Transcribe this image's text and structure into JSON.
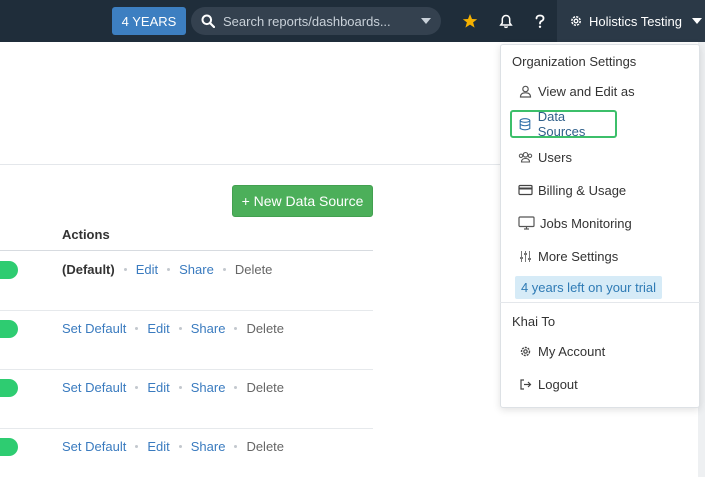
{
  "topbar": {
    "plan_badge": "4 YEARS",
    "search_placeholder": "Search reports/dashboards...",
    "icons": [
      "star-icon",
      "bell-icon",
      "help-icon",
      "gear-icon"
    ],
    "org_name": "Holistics Testing",
    "colors": {
      "bar": "#1f2d3a",
      "badge": "#3d7fc1",
      "star": "#f5b100"
    }
  },
  "main": {
    "new_button_label": "+ New Data Source",
    "actions_header": "Actions",
    "rows": [
      {
        "default_label": "(Default)",
        "edit": "Edit",
        "share": "Share",
        "delete": "Delete"
      },
      {
        "set_default": "Set Default",
        "edit": "Edit",
        "share": "Share",
        "delete": "Delete"
      },
      {
        "set_default": "Set Default",
        "edit": "Edit",
        "share": "Share",
        "delete": "Delete"
      },
      {
        "set_default": "Set Default",
        "edit": "Edit",
        "share": "Share",
        "delete": "Delete"
      }
    ],
    "toggle_color": "#2ecc71"
  },
  "menu": {
    "org_section": "Organization Settings",
    "items": [
      {
        "label": "View and Edit as",
        "icon": "user-icon"
      },
      {
        "label": "Data Sources",
        "icon": "database-icon"
      },
      {
        "label": "Users",
        "icon": "users-icon"
      },
      {
        "label": "Billing & Usage",
        "icon": "credit-card-icon"
      },
      {
        "label": "Jobs Monitoring",
        "icon": "monitor-icon"
      },
      {
        "label": "More Settings",
        "icon": "sliders-icon"
      }
    ],
    "trial_badge": "4 years left on your trial",
    "user_section": "Khai To",
    "account_items": [
      {
        "label": "My Account",
        "icon": "gear-icon"
      },
      {
        "label": "Logout",
        "icon": "logout-icon"
      }
    ],
    "active_color": "#3cbf6a"
  }
}
